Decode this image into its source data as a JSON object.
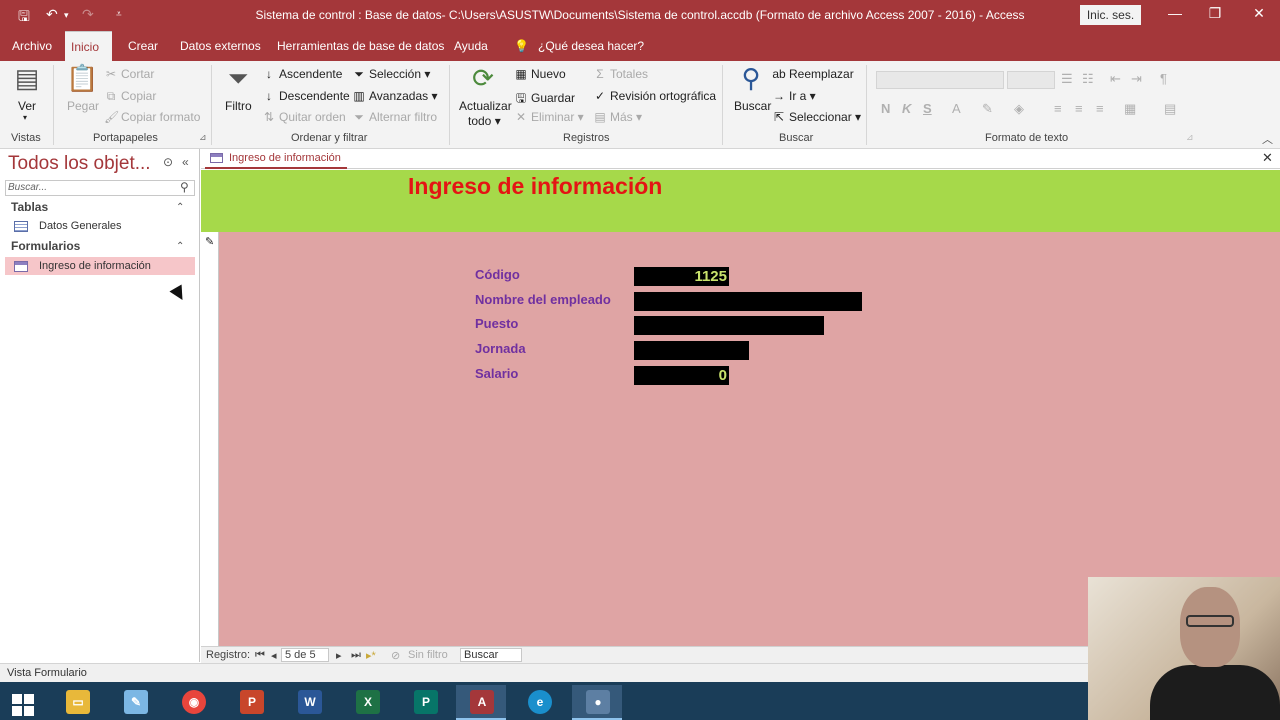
{
  "window": {
    "title": "Sistema de control : Base de datos- C:\\Users\\ASUSTW\\Documents\\Sistema de control.accdb (Formato de archivo Access 2007 - 2016)  -  Access",
    "signin_label": "Inic. ses."
  },
  "tabs": [
    "Archivo",
    "Inicio",
    "Crear",
    "Datos externos",
    "Herramientas de base de datos",
    "Ayuda",
    "¿Qué desea hacer?"
  ],
  "ribbon": {
    "vistas": {
      "ver": "Ver",
      "group": "Vistas"
    },
    "portapapeles": {
      "pegar": "Pegar",
      "cortar": "Cortar",
      "copiar": "Copiar",
      "copiar_formato": "Copiar formato",
      "group": "Portapapeles"
    },
    "ordenar": {
      "filtro": "Filtro",
      "ascendente": "Ascendente",
      "descendente": "Descendente",
      "quitar_orden": "Quitar orden",
      "seleccion": "Selección",
      "avanzadas": "Avanzadas",
      "alternar": "Alternar filtro",
      "group": "Ordenar y filtrar"
    },
    "registros": {
      "actualizar": "Actualizar",
      "todo": "todo",
      "nuevo": "Nuevo",
      "guardar": "Guardar",
      "eliminar": "Eliminar",
      "totales": "Totales",
      "revision": "Revisión ortográfica",
      "mas": "Más",
      "group": "Registros"
    },
    "buscar": {
      "buscar": "Buscar",
      "reemplazar": "Reemplazar",
      "ir_a": "Ir a",
      "seleccionar": "Seleccionar",
      "group": "Buscar"
    },
    "formato": {
      "n": "N",
      "k": "K",
      "s": "S",
      "group": "Formato de texto"
    }
  },
  "nav": {
    "title": "Todos los objet...",
    "search_placeholder": "Buscar...",
    "sections": [
      {
        "label": "Tablas",
        "items": [
          "Datos Generales"
        ]
      },
      {
        "label": "Formularios",
        "items": [
          "Ingreso de información"
        ]
      }
    ]
  },
  "document": {
    "tab_label": "Ingreso de información",
    "form_title": "Ingreso de información",
    "fields": [
      {
        "label": "Código",
        "value": "1125"
      },
      {
        "label": "Nombre del empleado",
        "value": ""
      },
      {
        "label": "Puesto",
        "value": ""
      },
      {
        "label": "Jornada",
        "value": ""
      },
      {
        "label": "Salario",
        "value": "0"
      }
    ]
  },
  "record_nav": {
    "label": "Registro:",
    "position": "5 de 5",
    "filter": "Sin filtro",
    "search": "Buscar"
  },
  "status": {
    "view": "Vista Formulario"
  },
  "taskbar_apps": [
    "start",
    "file-explorer",
    "paint",
    "chrome",
    "powerpoint",
    "word",
    "excel",
    "publisher",
    "access",
    "edge",
    "media-recorder"
  ],
  "colors": {
    "access_brand": "#a4373a",
    "form_header_bg": "#a6d94a",
    "form_body_bg": "#dfa4a4",
    "form_title": "#e41414",
    "field_label": "#7030a0",
    "field_box": "#000000",
    "field_value": "#c9e26c"
  }
}
